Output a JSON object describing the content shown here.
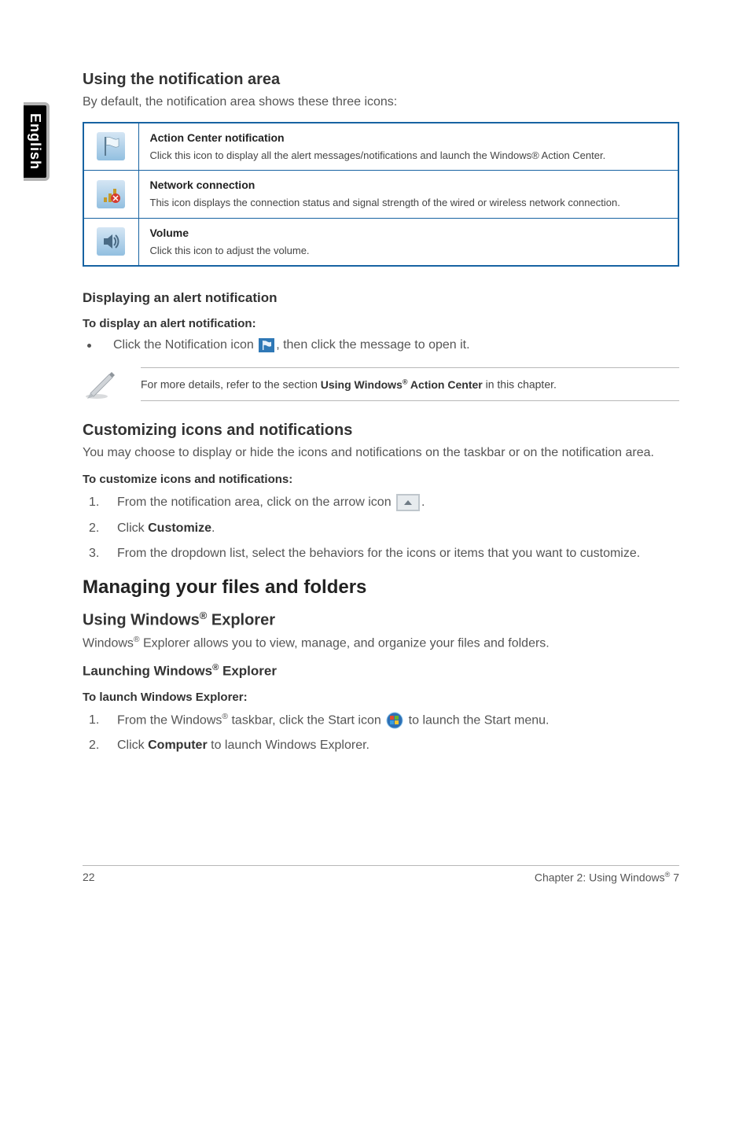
{
  "sideTab": "English",
  "sec1": {
    "heading": "Using the notification area",
    "intro": "By default, the notification area shows these three icons:"
  },
  "table": [
    {
      "title": "Action Center notification",
      "desc": "Click this icon to display all the alert messages/notifications and launch the Windows® Action Center."
    },
    {
      "title": "Network connection",
      "desc": "This icon displays the connection status and signal strength of the wired or wireless network connection."
    },
    {
      "title": "Volume",
      "desc": "Click this icon to adjust the volume."
    }
  ],
  "alert": {
    "heading": "Displaying an alert notification",
    "sub": "To display an alert notification:",
    "line_pre": "Click the Notification icon ",
    "line_post": ", then click the message to open it."
  },
  "note": {
    "pre": "For more details, refer to the section ",
    "bold": "Using Windows® Action Center",
    "post": " in this chapter."
  },
  "custom": {
    "heading": "Customizing icons and notifications",
    "intro": "You may choose to display or hide the icons and notifications on the taskbar or on the notification area.",
    "sub": "To customize icons and notifications:",
    "step1_pre": "From the notification area, click on the arrow icon ",
    "step1_post": ".",
    "step2_pre": "Click ",
    "step2_bold": "Customize",
    "step2_post": ".",
    "step3": "From the dropdown list, select the behaviors for the icons or items that you want to customize."
  },
  "manage": {
    "heading": "Managing your files and folders",
    "sub1": "Using Windows® Explorer",
    "intro": "Windows® Explorer allows you to view, manage, and organize your files and folders.",
    "sub2": "Launching Windows® Explorer",
    "sub3": "To launch Windows Explorer:",
    "step1_pre": "From the Windows® taskbar, click the Start icon ",
    "step1_post": " to launch the Start menu.",
    "step2_pre": "Click ",
    "step2_bold": "Computer",
    "step2_post": " to launch Windows Explorer."
  },
  "footer": {
    "left": "22",
    "right": "Chapter 2: Using Windows® 7"
  }
}
